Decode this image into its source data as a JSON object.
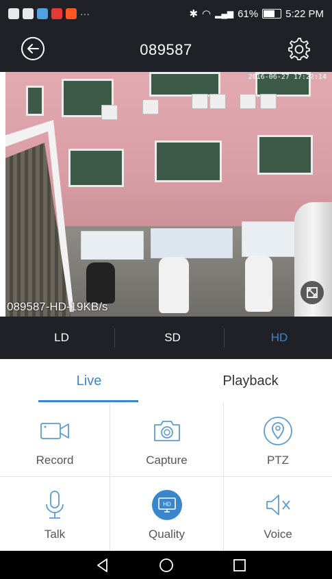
{
  "status_bar": {
    "notification_icons": [
      "chat-icon",
      "mail-icon",
      "gallery-icon",
      "red-app-icon",
      "orange-app-icon"
    ],
    "overflow": "···",
    "battery": "61%",
    "time": "5:22 PM"
  },
  "header": {
    "title": "089587"
  },
  "video": {
    "timestamp": "2016-06-27 17:22:14",
    "stream_label": "089587-HD-19KB/s"
  },
  "quality": {
    "options": [
      "LD",
      "SD",
      "HD"
    ],
    "selected": "HD",
    "selected_color": "#3a86cc"
  },
  "tabs": {
    "items": [
      "Live",
      "Playback"
    ],
    "active": "Live"
  },
  "controls": [
    {
      "label": "Record",
      "icon": "video-camera-icon"
    },
    {
      "label": "Capture",
      "icon": "camera-icon"
    },
    {
      "label": "PTZ",
      "icon": "location-pin-icon"
    },
    {
      "label": "Talk",
      "icon": "microphone-icon"
    },
    {
      "label": "Quality",
      "icon": "hd-monitor-icon"
    },
    {
      "label": "Voice",
      "icon": "speaker-muted-icon"
    }
  ],
  "colors": {
    "accent": "#3a86cc",
    "dark_bar": "#1f2126"
  }
}
